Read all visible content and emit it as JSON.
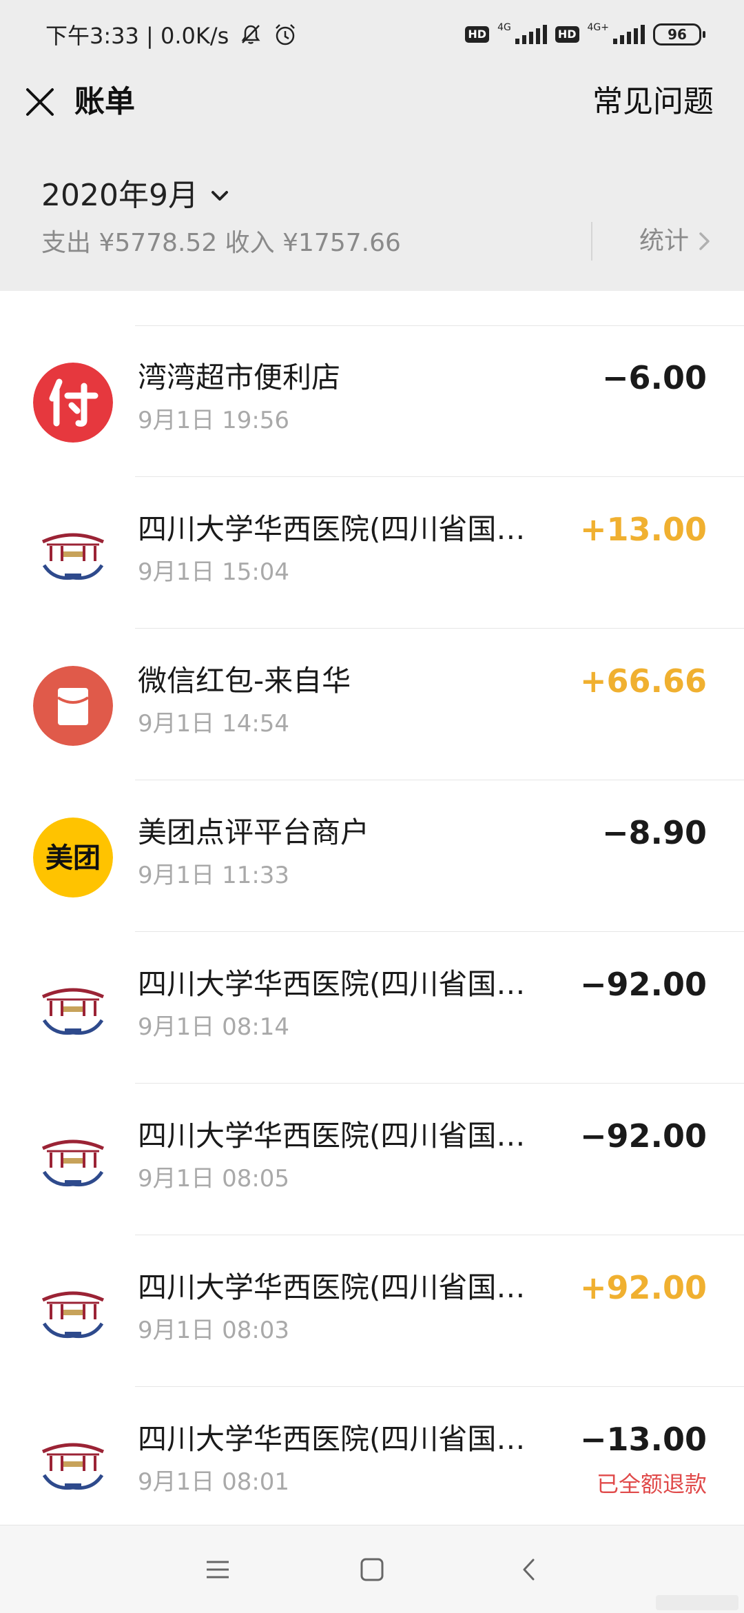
{
  "status_bar": {
    "time_speed": "下午3:33 | 0.0K/s",
    "hd_label": "HD",
    "network_1": "4G",
    "network_2": "4G+",
    "battery": "96"
  },
  "nav": {
    "title": "账单",
    "faq": "常见问题"
  },
  "summary": {
    "month": "2020年9月",
    "totals": "支出 ¥5778.52 收入 ¥1757.66",
    "stats_label": "统计"
  },
  "colors": {
    "income": "#f0b030",
    "refund": "#e04a4a",
    "background": "#ededed"
  },
  "transactions": [
    {
      "icon": "pay-icon",
      "name": "湾湾超市便利店",
      "time": "9月1日 19:56",
      "amount": "−6.00",
      "type": "expense",
      "status": ""
    },
    {
      "icon": "hospital-logo-icon",
      "name": "四川大学华西医院(四川省国…",
      "time": "9月1日 15:04",
      "amount": "+13.00",
      "type": "income",
      "status": ""
    },
    {
      "icon": "red-packet-icon",
      "name": "微信红包-来自华",
      "time": "9月1日 14:54",
      "amount": "+66.66",
      "type": "income",
      "status": ""
    },
    {
      "icon": "meituan-icon",
      "name": "美团点评平台商户",
      "time": "9月1日 11:33",
      "amount": "−8.90",
      "type": "expense",
      "status": "",
      "icon_text": "美团"
    },
    {
      "icon": "hospital-logo-icon",
      "name": "四川大学华西医院(四川省国…",
      "time": "9月1日 08:14",
      "amount": "−92.00",
      "type": "expense",
      "status": ""
    },
    {
      "icon": "hospital-logo-icon",
      "name": "四川大学华西医院(四川省国…",
      "time": "9月1日 08:05",
      "amount": "−92.00",
      "type": "expense",
      "status": ""
    },
    {
      "icon": "hospital-logo-icon",
      "name": "四川大学华西医院(四川省国…",
      "time": "9月1日 08:03",
      "amount": "+92.00",
      "type": "income",
      "status": ""
    },
    {
      "icon": "hospital-logo-icon",
      "name": "四川大学华西医院(四川省国…",
      "time": "9月1日 08:01",
      "amount": "−13.00",
      "type": "expense",
      "status": "已全额退款"
    }
  ]
}
